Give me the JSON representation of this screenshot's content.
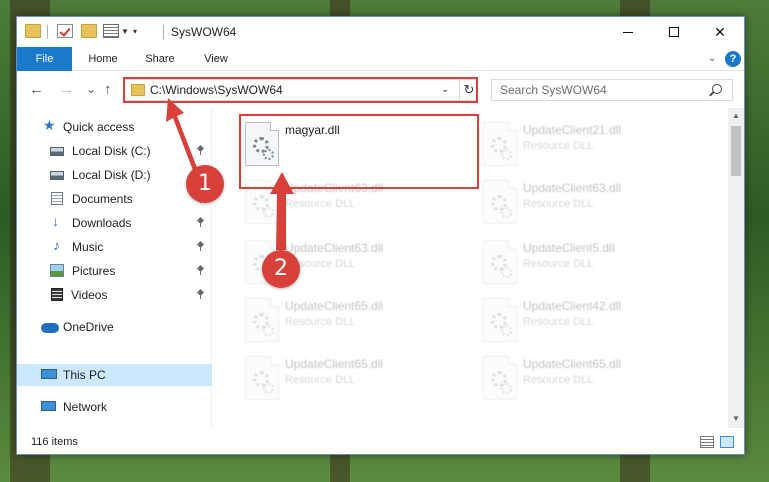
{
  "window": {
    "title": "SysWOW64",
    "minimize_glyph": "—",
    "maximize_glyph": "☐",
    "close_glyph": "✕"
  },
  "ribbon": {
    "tabs": [
      {
        "label": "File"
      },
      {
        "label": "Home"
      },
      {
        "label": "Share"
      },
      {
        "label": "View"
      }
    ],
    "help_glyph": "?"
  },
  "navigation": {
    "back_glyph": "←",
    "forward_glyph": "→",
    "recent_glyph": "⌄",
    "up_glyph": "↑",
    "address": "C:\\Windows\\SysWOW64",
    "refresh_glyph": "↻",
    "search_placeholder": "Search SysWOW64"
  },
  "sidebar": {
    "items": [
      {
        "label": "Quick access",
        "icon": "star-icon",
        "pinned": false
      },
      {
        "label": "Local Disk (C:)",
        "icon": "drive-icon",
        "pinned": true
      },
      {
        "label": "Local Disk (D:)",
        "icon": "drive-icon",
        "pinned": false
      },
      {
        "label": "Documents",
        "icon": "documents-icon",
        "pinned": true
      },
      {
        "label": "Downloads",
        "icon": "download-icon",
        "pinned": true
      },
      {
        "label": "Music",
        "icon": "music-icon",
        "pinned": true
      },
      {
        "label": "Pictures",
        "icon": "pictures-icon",
        "pinned": true
      },
      {
        "label": "Videos",
        "icon": "videos-icon",
        "pinned": true
      },
      {
        "label": "OneDrive",
        "icon": "cloud-icon",
        "pinned": false
      },
      {
        "label": "This PC",
        "icon": "computer-icon",
        "pinned": false,
        "selected": true
      },
      {
        "label": "Network",
        "icon": "network-icon",
        "pinned": false
      }
    ]
  },
  "files": [
    {
      "name": "magyar.dll",
      "type": "",
      "highlighted": true
    },
    {
      "name": "UpdateClient21.dll",
      "type": "Resource DLL"
    },
    {
      "name": "UpdateClient63.dll",
      "type": "Resource DLL"
    },
    {
      "name": "UpdateClient63.dll",
      "type": "Resource DLL"
    },
    {
      "name": "UpdateClient63.dll",
      "type": "Resource DLL"
    },
    {
      "name": "UpdateClient5.dll",
      "type": "Resource DLL"
    },
    {
      "name": "UpdateClient65.dll",
      "type": "Resource DLL"
    },
    {
      "name": "UpdateClient42.dll",
      "type": "Resource DLL"
    },
    {
      "name": "UpdateClient65.dll",
      "type": "Resource DLL"
    },
    {
      "name": "UpdateClient65.dll",
      "type": "Resource DLL"
    }
  ],
  "status": {
    "item_count": "116 items"
  },
  "annotations": {
    "step1": "1",
    "step2": "2",
    "color": "#d8403a"
  },
  "colors": {
    "accent": "#1979ca",
    "selection": "#cce8ff",
    "annotation": "#d8403a"
  }
}
